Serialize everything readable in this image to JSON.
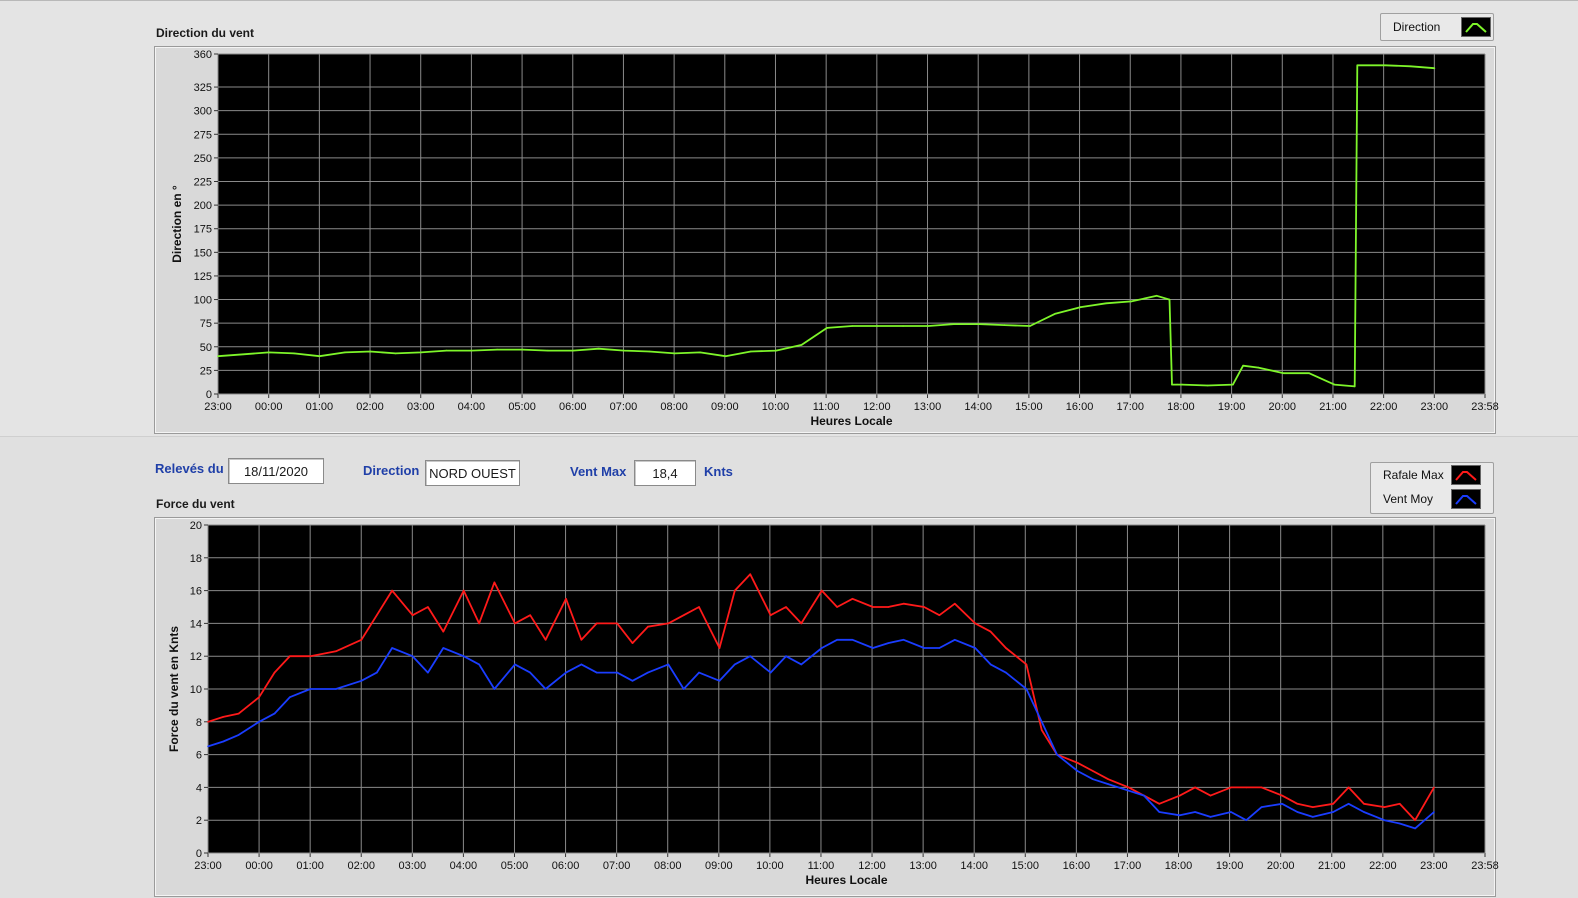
{
  "top_chart": {
    "title": "Direction du vent",
    "legend": [
      {
        "label": "Direction",
        "color": "#7ef52a"
      }
    ]
  },
  "info": {
    "releves_label": "Relevés du",
    "releves_value": "18/11/2020",
    "direction_label": "Direction",
    "direction_value": "NORD OUEST",
    "vent_max_label": "Vent Max",
    "vent_max_value": "18,4",
    "vent_max_unit": "Knts"
  },
  "bottom_chart": {
    "title": "Force du vent",
    "legend": [
      {
        "label": "Rafale Max",
        "color": "#ff1a1a"
      },
      {
        "label": "Vent Moy",
        "color": "#1a3dff"
      }
    ]
  },
  "chart_data": [
    {
      "type": "line",
      "xlabel": "Heures Locale",
      "ylabel": "Direction en °",
      "x_ticks": [
        "23:00",
        "00:00",
        "01:00",
        "02:00",
        "03:00",
        "04:00",
        "05:00",
        "06:00",
        "07:00",
        "08:00",
        "09:00",
        "10:00",
        "11:00",
        "12:00",
        "13:00",
        "14:00",
        "15:00",
        "16:00",
        "17:00",
        "18:00",
        "19:00",
        "20:00",
        "21:00",
        "22:00",
        "23:00",
        "23:58"
      ],
      "y_ticks": [
        0,
        25,
        50,
        75,
        100,
        125,
        150,
        175,
        200,
        225,
        250,
        275,
        300,
        325,
        360
      ],
      "ylim": [
        0,
        360
      ],
      "grid": true,
      "legend_position": "top-right",
      "series": [
        {
          "name": "Direction",
          "color": "#7ef52a",
          "x": [
            0,
            0.5,
            1,
            1.5,
            2,
            2.5,
            3,
            3.5,
            4,
            4.5,
            5,
            5.5,
            6,
            6.5,
            7,
            7.5,
            8,
            8.5,
            9,
            9.5,
            10,
            10.5,
            11,
            11.5,
            12,
            12.5,
            13,
            13.5,
            14,
            14.5,
            15,
            15.5,
            16,
            16.5,
            17,
            17.5,
            18,
            18.5,
            18.75,
            18.8,
            18.9,
            19,
            19.5,
            20,
            20.2,
            20.5,
            21,
            21.5,
            22,
            22.4,
            22.45,
            23,
            23.5,
            23.97
          ],
          "y": [
            40,
            42,
            44,
            43,
            40,
            44,
            45,
            43,
            44,
            46,
            46,
            47,
            47,
            46,
            46,
            48,
            46,
            45,
            43,
            44,
            40,
            45,
            46,
            52,
            70,
            72,
            72,
            72,
            72,
            74,
            74,
            73,
            72,
            85,
            92,
            96,
            98,
            104,
            100,
            10,
            10,
            10,
            9,
            10,
            30,
            28,
            22,
            22,
            10,
            8,
            348,
            348,
            347,
            345
          ]
        }
      ]
    },
    {
      "type": "line",
      "xlabel": "Heures Locale",
      "ylabel": "Force du vent en Knts",
      "x_ticks": [
        "23:00",
        "00:00",
        "01:00",
        "02:00",
        "03:00",
        "04:00",
        "05:00",
        "06:00",
        "07:00",
        "08:00",
        "09:00",
        "10:00",
        "11:00",
        "12:00",
        "13:00",
        "14:00",
        "15:00",
        "16:00",
        "17:00",
        "18:00",
        "19:00",
        "20:00",
        "21:00",
        "22:00",
        "23:00",
        "23:58"
      ],
      "y_ticks": [
        0,
        2,
        4,
        6,
        8,
        10,
        12,
        14,
        16,
        18,
        20
      ],
      "ylim": [
        0,
        20
      ],
      "grid": true,
      "legend_position": "top-right",
      "series": [
        {
          "name": "Rafale Max",
          "color": "#ff1a1a",
          "x": [
            0,
            0.3,
            0.6,
            1,
            1.3,
            1.6,
            2,
            2.5,
            3,
            3.3,
            3.6,
            4,
            4.3,
            4.6,
            5,
            5.3,
            5.6,
            6,
            6.3,
            6.6,
            7,
            7.3,
            7.6,
            8,
            8.3,
            8.6,
            9,
            9.3,
            9.6,
            10,
            10.3,
            10.6,
            11,
            11.3,
            11.6,
            12,
            12.3,
            12.6,
            13,
            13.3,
            13.6,
            14,
            14.3,
            14.6,
            15,
            15.3,
            15.6,
            16,
            16.3,
            16.6,
            17,
            17.3,
            17.6,
            18,
            18.3,
            18.6,
            19,
            19.3,
            19.6,
            20,
            20.3,
            20.6,
            21,
            21.3,
            21.6,
            22,
            22.3,
            22.6,
            23,
            23.3,
            23.6,
            23.97
          ],
          "y": [
            8,
            8.3,
            8.5,
            9.5,
            11,
            12,
            12,
            12.3,
            13,
            14.5,
            16,
            14.5,
            15,
            13.5,
            16,
            14,
            16.5,
            14,
            14.5,
            13,
            15.5,
            13,
            14,
            14,
            12.8,
            13.8,
            14,
            14.5,
            15,
            12.5,
            16,
            17,
            14.5,
            15,
            14,
            16,
            15,
            15.5,
            15,
            15,
            15.2,
            15,
            14.5,
            15.2,
            14,
            13.5,
            12.5,
            11.5,
            7.5,
            6,
            5.5,
            5,
            4.5,
            4,
            3.5,
            3,
            3.5,
            4,
            3.5,
            4,
            4,
            4,
            3.5,
            3,
            2.8,
            3,
            4,
            3,
            2.8,
            3,
            2,
            4
          ]
        },
        {
          "name": "Vent Moy",
          "color": "#1a3dff",
          "x": [
            0,
            0.3,
            0.6,
            1,
            1.3,
            1.6,
            2,
            2.5,
            3,
            3.3,
            3.6,
            4,
            4.3,
            4.6,
            5,
            5.3,
            5.6,
            6,
            6.3,
            6.6,
            7,
            7.3,
            7.6,
            8,
            8.3,
            8.6,
            9,
            9.3,
            9.6,
            10,
            10.3,
            10.6,
            11,
            11.3,
            11.6,
            12,
            12.3,
            12.6,
            13,
            13.3,
            13.6,
            14,
            14.3,
            14.6,
            15,
            15.3,
            15.6,
            16,
            16.3,
            16.6,
            17,
            17.3,
            17.6,
            18,
            18.3,
            18.6,
            19,
            19.3,
            19.6,
            20,
            20.3,
            20.6,
            21,
            21.3,
            21.6,
            22,
            22.3,
            22.6,
            23,
            23.3,
            23.6,
            23.97
          ],
          "y": [
            6.5,
            6.8,
            7.2,
            8,
            8.5,
            9.5,
            10,
            10,
            10.5,
            11,
            12.5,
            12,
            11,
            12.5,
            12,
            11.5,
            10,
            11.5,
            11,
            10,
            11,
            11.5,
            11,
            11,
            10.5,
            11,
            11.5,
            10,
            11,
            10.5,
            11.5,
            12,
            11,
            12,
            11.5,
            12.5,
            13,
            13,
            12.5,
            12.8,
            13,
            12.5,
            12.5,
            13,
            12.5,
            11.5,
            11,
            10,
            8,
            6,
            5,
            4.5,
            4.2,
            3.8,
            3.5,
            2.5,
            2.3,
            2.5,
            2.2,
            2.5,
            2,
            2.8,
            3,
            2.5,
            2.2,
            2.5,
            3,
            2.5,
            2,
            1.8,
            1.5,
            2.5
          ]
        }
      ]
    }
  ]
}
